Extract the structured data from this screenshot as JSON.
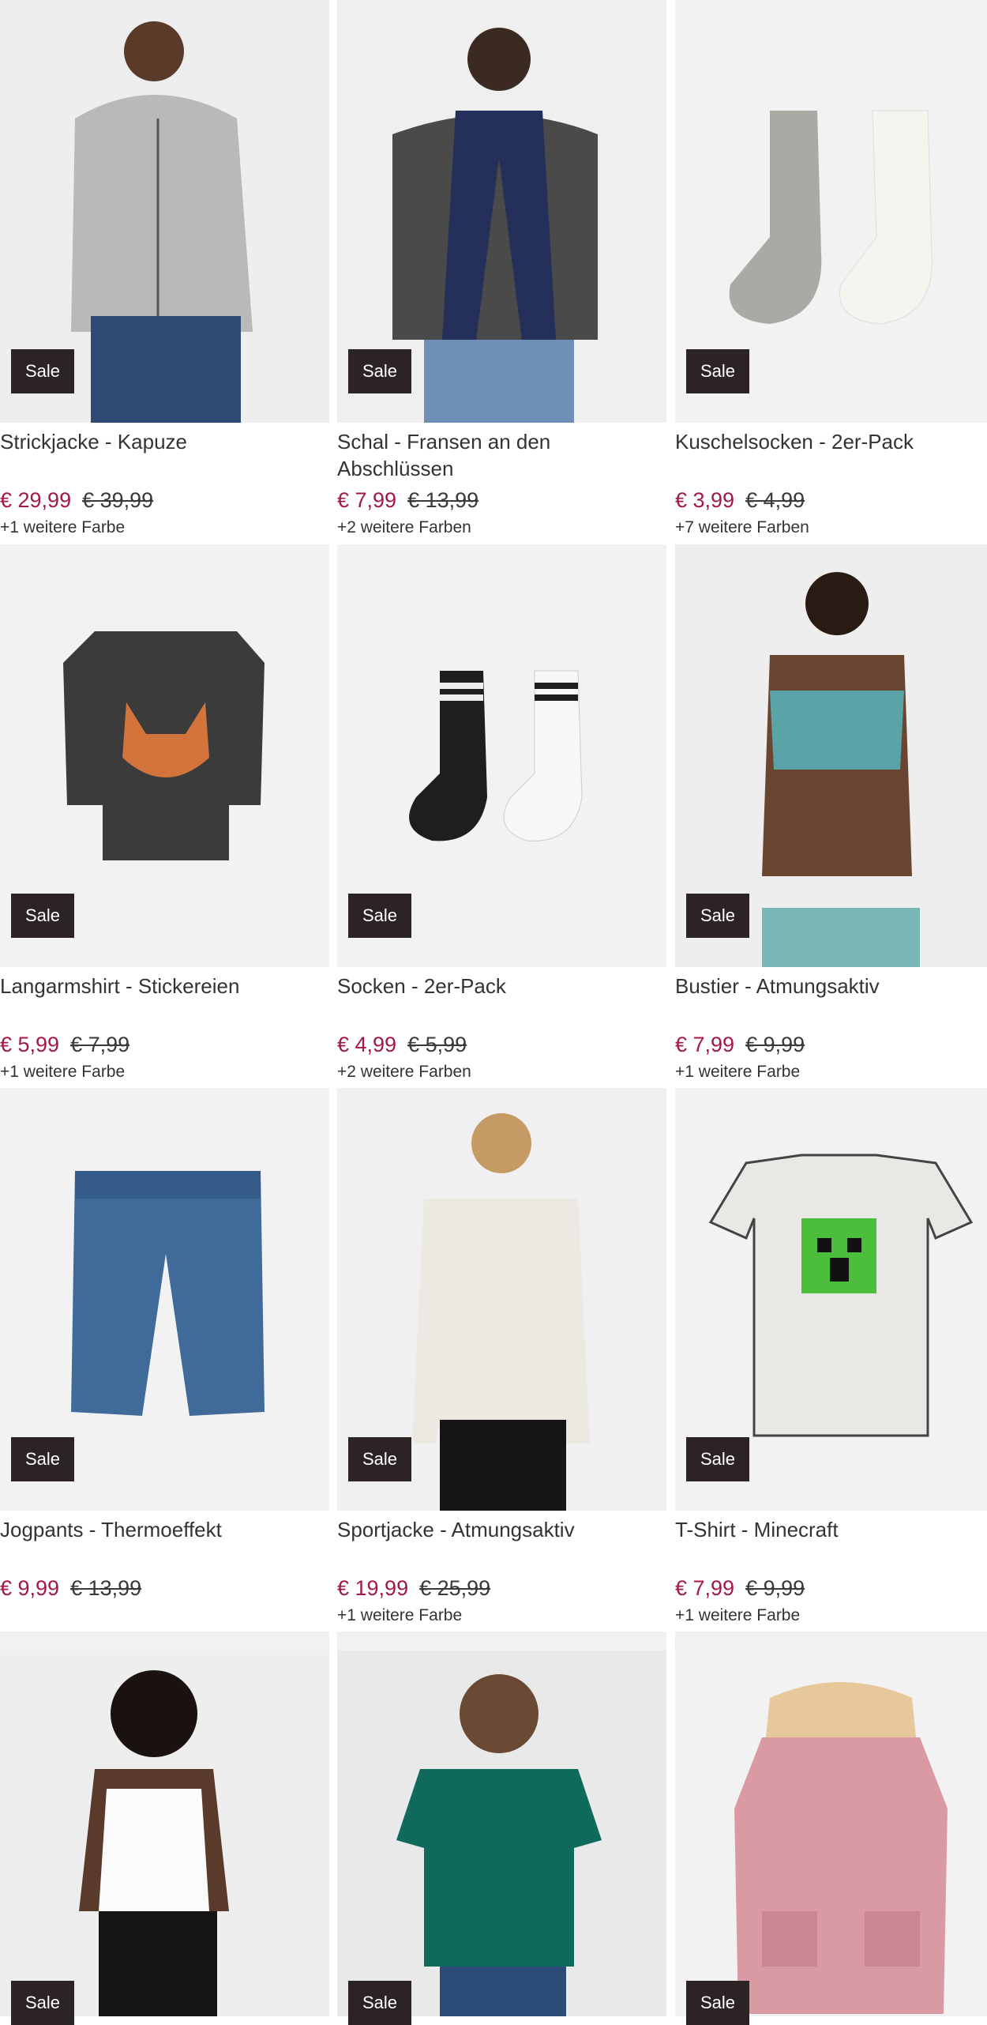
{
  "products": [
    {
      "name": "Strickjacke - Kapuze",
      "price": "€ 29,99",
      "old_price": "€ 39,99",
      "colors": "+1 weitere Farbe",
      "badge": "Sale",
      "image_icon": "hoodie-man-image"
    },
    {
      "name": "Schal - Fransen an den Abschlüssen",
      "price": "€ 7,99",
      "old_price": "€ 13,99",
      "colors": "+2 weitere Farben",
      "badge": "Sale",
      "image_icon": "scarf-woman-image"
    },
    {
      "name": "Kuschelsocken - 2er-Pack",
      "price": "€ 3,99",
      "old_price": "€ 4,99",
      "colors": "+7 weitere Farben",
      "badge": "Sale",
      "image_icon": "fuzzy-socks-image"
    },
    {
      "name": "Langarmshirt - Stickereien",
      "price": "€ 5,99",
      "old_price": "€ 7,99",
      "colors": "+1 weitere Farbe",
      "badge": "Sale",
      "image_icon": "fox-shirt-image"
    },
    {
      "name": "Socken - 2er-Pack",
      "price": "€ 4,99",
      "old_price": "€ 5,99",
      "colors": "+2 weitere Farben",
      "badge": "Sale",
      "image_icon": "sport-socks-image"
    },
    {
      "name": "Bustier - Atmungsaktiv",
      "price": "€ 7,99",
      "old_price": "€ 9,99",
      "colors": "+1 weitere Farbe",
      "badge": "Sale",
      "image_icon": "bustier-image"
    },
    {
      "name": "Jogpants - Thermoeffekt",
      "price": "€ 9,99",
      "old_price": "€ 13,99",
      "colors": "",
      "badge": "Sale",
      "image_icon": "baby-jeans-image"
    },
    {
      "name": "Sportjacke - Atmungsaktiv",
      "price": "€ 19,99",
      "old_price": "€ 25,99",
      "colors": "+1 weitere Farbe",
      "badge": "Sale",
      "image_icon": "sport-jacket-image"
    },
    {
      "name": "T-Shirt - Minecraft",
      "price": "€ 7,99",
      "old_price": "€ 9,99",
      "colors": "+1 weitere Farbe",
      "badge": "Sale",
      "image_icon": "minecraft-tshirt-image"
    },
    {
      "name": "",
      "price": "",
      "old_price": "",
      "colors": "",
      "badge": "Sale",
      "image_icon": "white-tanktop-image"
    },
    {
      "name": "",
      "price": "",
      "old_price": "",
      "colors": "",
      "badge": "Sale",
      "image_icon": "green-tshirt-image"
    },
    {
      "name": "",
      "price": "",
      "old_price": "",
      "colors": "",
      "badge": "Sale",
      "image_icon": "pink-parka-image"
    }
  ]
}
